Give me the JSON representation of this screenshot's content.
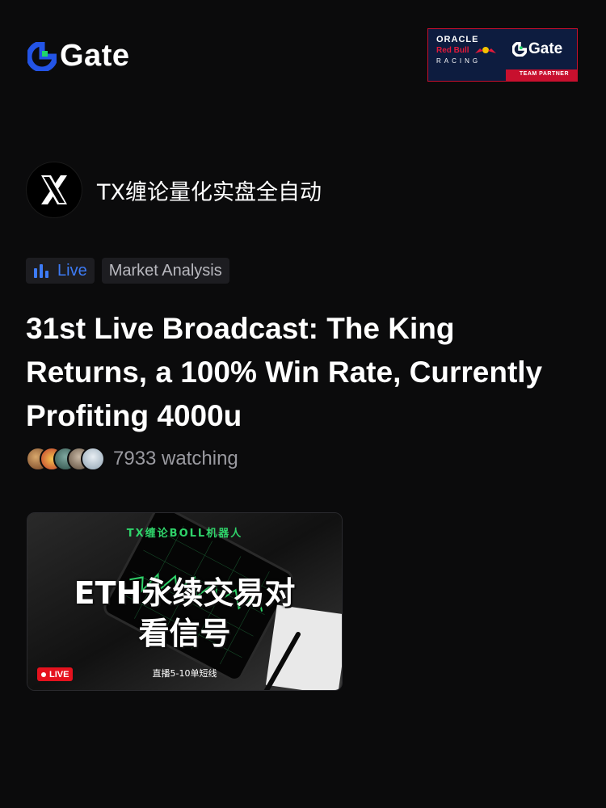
{
  "header": {
    "brand": "Gate",
    "partner": {
      "line1": "ORACLE",
      "line2": "Red Bull",
      "line3": "RACING",
      "brand": "Gate",
      "strip": "TEAM PARTNER"
    }
  },
  "channel": {
    "name": "TX缠论量化实盘全自动"
  },
  "tags": {
    "live": "Live",
    "category": "Market Analysis"
  },
  "stream": {
    "title": "31st Live Broadcast: The King Returns, a 100% Win Rate, Currently Profiting 4000u",
    "watching": "7933 watching"
  },
  "thumbnail": {
    "top": "TX缠论BOLL机器人",
    "line1": "ETH永续交易对",
    "line2": "看信号",
    "bottom": "直播5-10单短线",
    "live_badge": "LIVE"
  },
  "colors": {
    "background": "#0b0b0c",
    "accent_blue": "#3d7bf5",
    "brand_green": "#1fd66b",
    "live_red": "#e5121e"
  }
}
